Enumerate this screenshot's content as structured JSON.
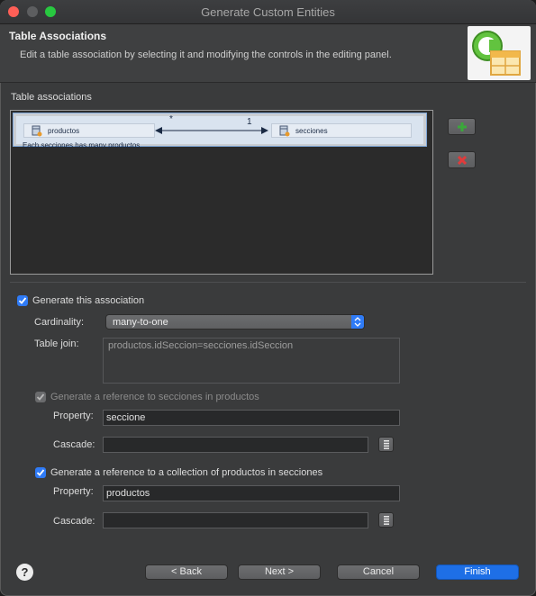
{
  "window": {
    "title": "Generate Custom Entities"
  },
  "header": {
    "title": "Table Associations",
    "description": "Edit a table association by selecting it and modifying the controls in the editing panel."
  },
  "associations": {
    "label": "Table associations",
    "items": [
      {
        "source_table": "productos",
        "target_table": "secciones",
        "source_cardinality": "*",
        "target_cardinality": "1",
        "caption": "Each secciones has many productos."
      }
    ]
  },
  "editor": {
    "generate_label": "Generate this association",
    "generate_checked": true,
    "cardinality_label": "Cardinality:",
    "cardinality_value": "many-to-one",
    "table_join_label": "Table join:",
    "table_join_value": "productos.idSeccion=secciones.idSeccion",
    "ref1": {
      "label": "Generate a reference to secciones in productos",
      "checked": true,
      "disabled": true,
      "property_label": "Property:",
      "property_value": "seccione",
      "cascade_label": "Cascade:",
      "cascade_value": ""
    },
    "ref2": {
      "label": "Generate a reference to a collection of productos in secciones",
      "checked": true,
      "disabled": false,
      "property_label": "Property:",
      "property_value": "productos",
      "cascade_label": "Cascade:",
      "cascade_value": ""
    }
  },
  "footer": {
    "help_label": "?",
    "back_label": "< Back",
    "next_label": "Next >",
    "cancel_label": "Cancel",
    "finish_label": "Finish"
  },
  "colors": {
    "accent": "#2f7bf6",
    "primary_button": "#1e6fe6",
    "remove_icon": "#e03b3b",
    "add_icon": "#3aa83a"
  }
}
